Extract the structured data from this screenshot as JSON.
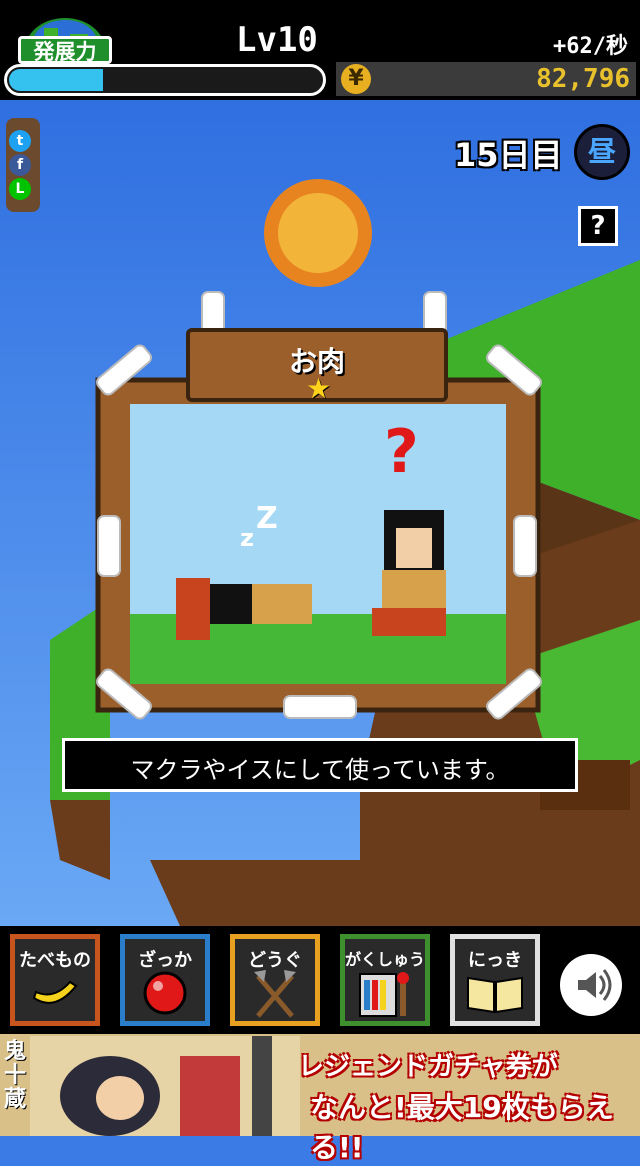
{
  "header": {
    "power_label": "発展力",
    "level": "Lv10",
    "rate": "+62/秒",
    "money": "82,796",
    "currency_symbol": "¥",
    "progress": 0.3
  },
  "social": {
    "twitter": "t",
    "facebook": "f",
    "line": "L"
  },
  "status": {
    "day": "15日目",
    "daytime": "昼",
    "help": "?"
  },
  "scene": {
    "title": "お肉",
    "star": "★",
    "caption": "マクラやイスにして使っています。"
  },
  "menu": {
    "items": [
      {
        "label": "たべもの",
        "color": "#c8541e"
      },
      {
        "label": "ざっか",
        "color": "#2a7ec9"
      },
      {
        "label": "どうぐ",
        "color": "#e8a020"
      },
      {
        "label": "がくしゅう",
        "color": "#3e8f2e"
      },
      {
        "label": "にっき",
        "color": "#e0e0e0"
      }
    ]
  },
  "ad": {
    "line1": "レジェンドガチャ券が",
    "line2": "なんと!最大19枚もらえる!!",
    "side_text": "鬼十蔵"
  }
}
